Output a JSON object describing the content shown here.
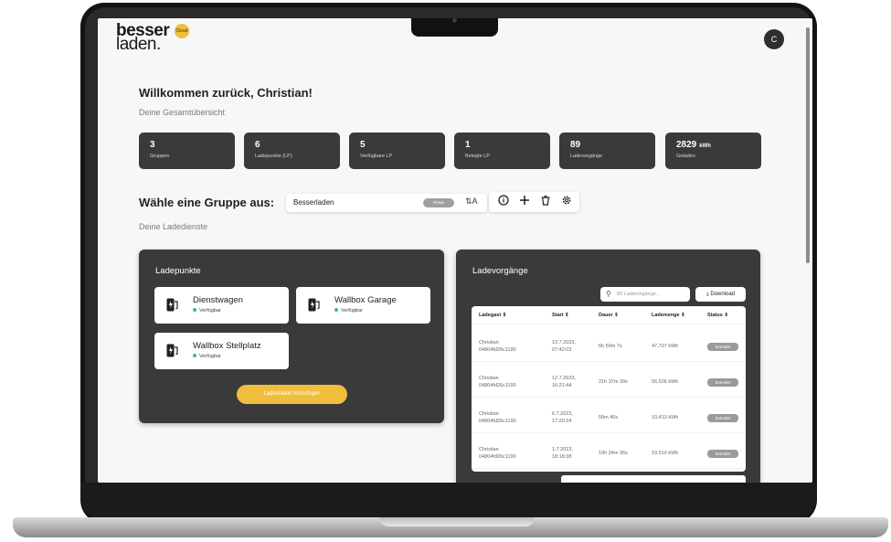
{
  "logo": {
    "line1": "besser",
    "line2": "laden.",
    "badge": "Cloud"
  },
  "avatar": {
    "initial": "C"
  },
  "welcome": {
    "title": "Willkommen zurück, Christian!",
    "subtitle": "Deine Gesamtübersicht"
  },
  "stats": [
    {
      "value": "3",
      "unit": "",
      "label": "Gruppen"
    },
    {
      "value": "6",
      "unit": "",
      "label": "Ladepunkte (LP)"
    },
    {
      "value": "5",
      "unit": "",
      "label": "Verfügbare LP"
    },
    {
      "value": "1",
      "unit": "",
      "label": "Belegte LP"
    },
    {
      "value": "89",
      "unit": "",
      "label": "Ladevorgänge"
    },
    {
      "value": "2829",
      "unit": "kWh",
      "label": "Geladen"
    }
  ],
  "group": {
    "title": "Wähle eine Gruppe aus:",
    "selected": "Besserladen",
    "tag": "Privat",
    "sort_icon": "⇅A"
  },
  "toolbar": {
    "icons": [
      "info-icon",
      "plus-icon",
      "trash-icon",
      "gear-icon"
    ]
  },
  "services_label": "Deine Ladedienste",
  "ladepunkte": {
    "title": "Ladepunkte",
    "items": [
      {
        "name": "Dienstwagen",
        "status": "Verfügbar"
      },
      {
        "name": "Wallbox Garage",
        "status": "Verfügbar"
      },
      {
        "name": "Wallbox Stellplatz",
        "status": "Verfügbar"
      }
    ],
    "add_button": "Ladestation hinzufügen"
  },
  "ladevorgaenge": {
    "title": "Ladevorgänge",
    "search_placeholder": "83 Ladevorgänge...",
    "download_label": "Download",
    "columns": [
      "Ladegast ⇕",
      "Start ⇕",
      "Dauer ⇕",
      "Lademenge ⇕",
      "Status ⇕"
    ],
    "rows": [
      {
        "guest": "Christian",
        "id": "04804fd26c1190",
        "date": "13.7.2023,",
        "time": "07:42:03",
        "duration": "6h 59m 7s",
        "amount": "47,727 kWh",
        "status": "beendet"
      },
      {
        "guest": "Christian",
        "id": "04804fd26c1190",
        "date": "12.7.2023,",
        "time": "16:21:44",
        "duration": "21h 37m 39s",
        "amount": "56,526 kWh",
        "status": "beendet"
      },
      {
        "guest": "Christian",
        "id": "04804fd26c1190",
        "date": "6.7.2023,",
        "time": "17:20:24",
        "duration": "59m 40s",
        "amount": "10,413 kWh",
        "status": "beendet"
      },
      {
        "guest": "Christian",
        "id": "04804fd26c1190",
        "date": "1.7.2023,",
        "time": "18:18:38",
        "duration": "19h 24m 36s",
        "amount": "19,510 kWh",
        "status": "beendet"
      }
    ]
  },
  "colors": {
    "accent": "#f0bd3c",
    "panel": "#3a3a3a",
    "available": "#35c46a"
  }
}
